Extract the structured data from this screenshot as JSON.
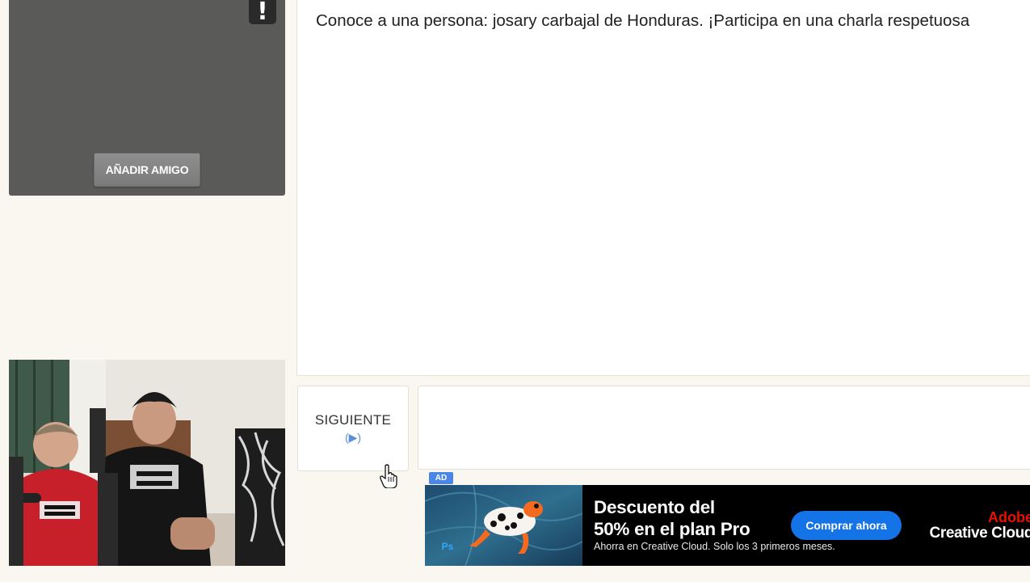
{
  "remote_video": {
    "add_friend_label": "AÑADIR AMIGO",
    "report_icon": "exclamation-icon",
    "report_glyph": "!"
  },
  "chat": {
    "messages": [
      "Conoce a una persona: josary carbajal de Honduras. ¡Participa en una charla respetuosa"
    ],
    "input_value": ""
  },
  "controls": {
    "next_label": "SIGUIENTE",
    "next_hint": "(▶)"
  },
  "ad": {
    "tag": "AD",
    "headline_line1": "Descuento del",
    "headline_line2": "50% en el plan Pro",
    "subtext": "Ahorra en Creative Cloud. Solo los 3 primeros meses.",
    "cta": "Comprar ahora",
    "brand_line1": "Adobe",
    "brand_line2": "Creative Cloud",
    "app_badge": "Ps",
    "colors": {
      "cta": "#1473e6",
      "brand": "#eb1000",
      "tag": "#4a86e8"
    }
  },
  "colors": {
    "page_background": "#faf6f0",
    "video_placeholder": "#5a5a59",
    "next_hint": "#5b8fd8"
  }
}
